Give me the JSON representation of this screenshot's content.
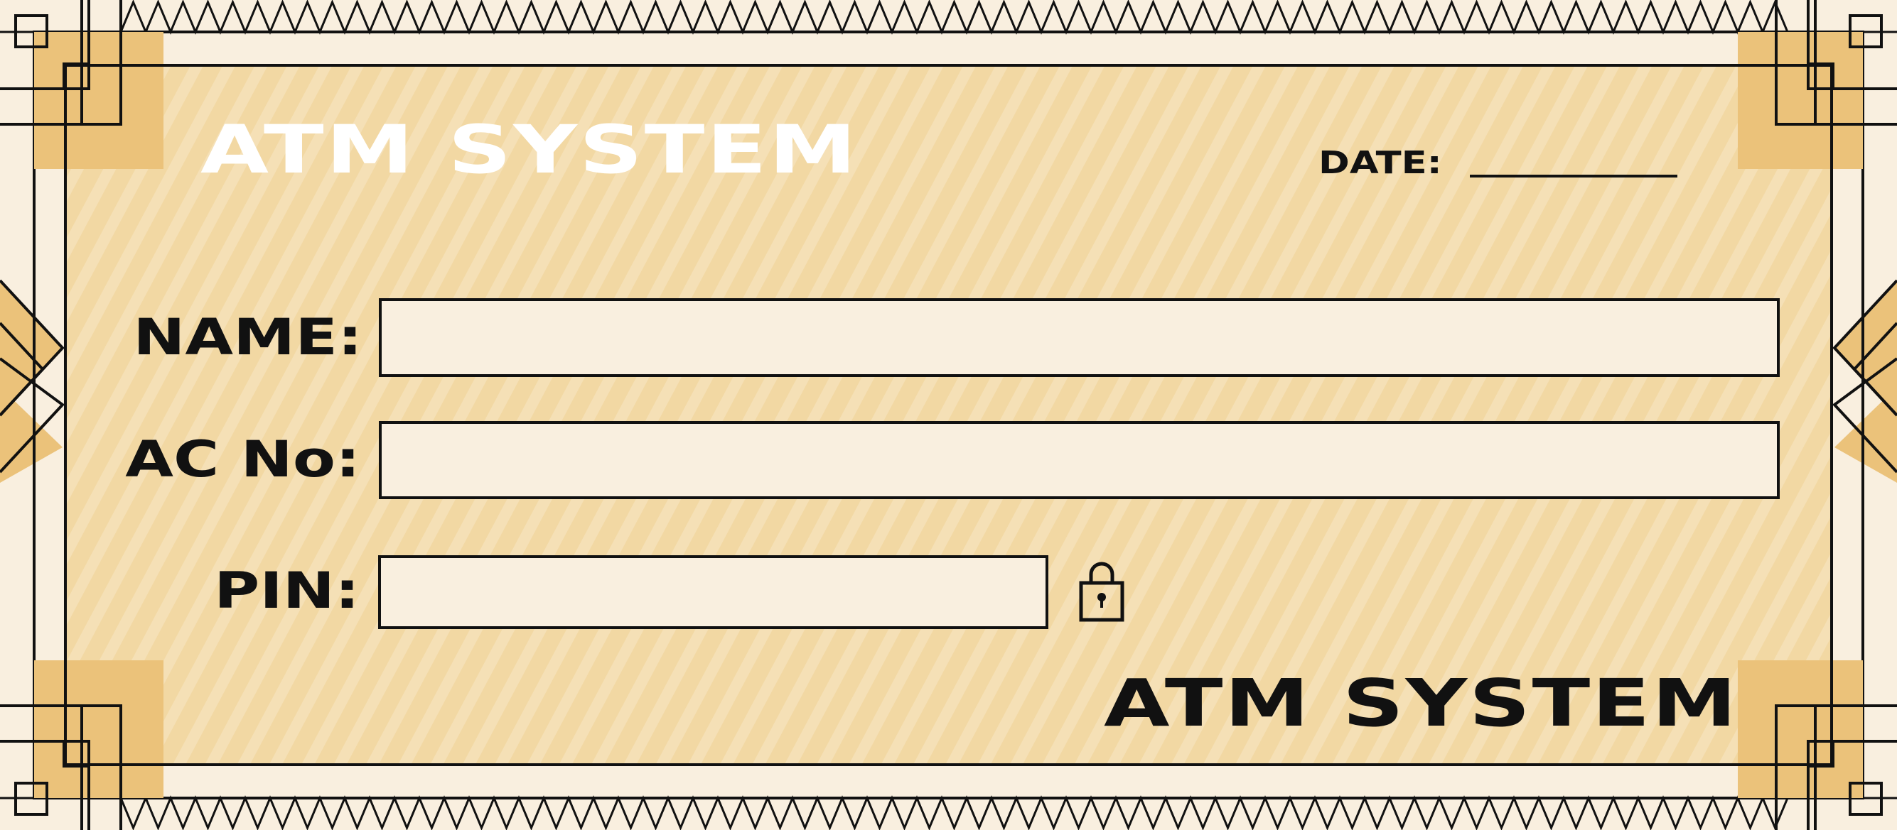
{
  "app": {
    "title_top": "ATM SYSTEM",
    "title_bottom": "ATM SYSTEM"
  },
  "date": {
    "label": "DATE:",
    "value": ""
  },
  "form": {
    "name": {
      "label": "NAME:",
      "value": "",
      "placeholder": ""
    },
    "account": {
      "label": "AC No:",
      "value": "",
      "placeholder": ""
    },
    "pin": {
      "label": "PIN:",
      "value": "",
      "placeholder": ""
    }
  },
  "icons": {
    "lock": "lock-icon"
  },
  "colors": {
    "background": "#f9efdf",
    "panel": "#f2d8a3",
    "panel_stripe": "#f5e0b6",
    "corner_accent": "#ebc27a",
    "ink": "#111111",
    "title_top": "#ffffff"
  }
}
